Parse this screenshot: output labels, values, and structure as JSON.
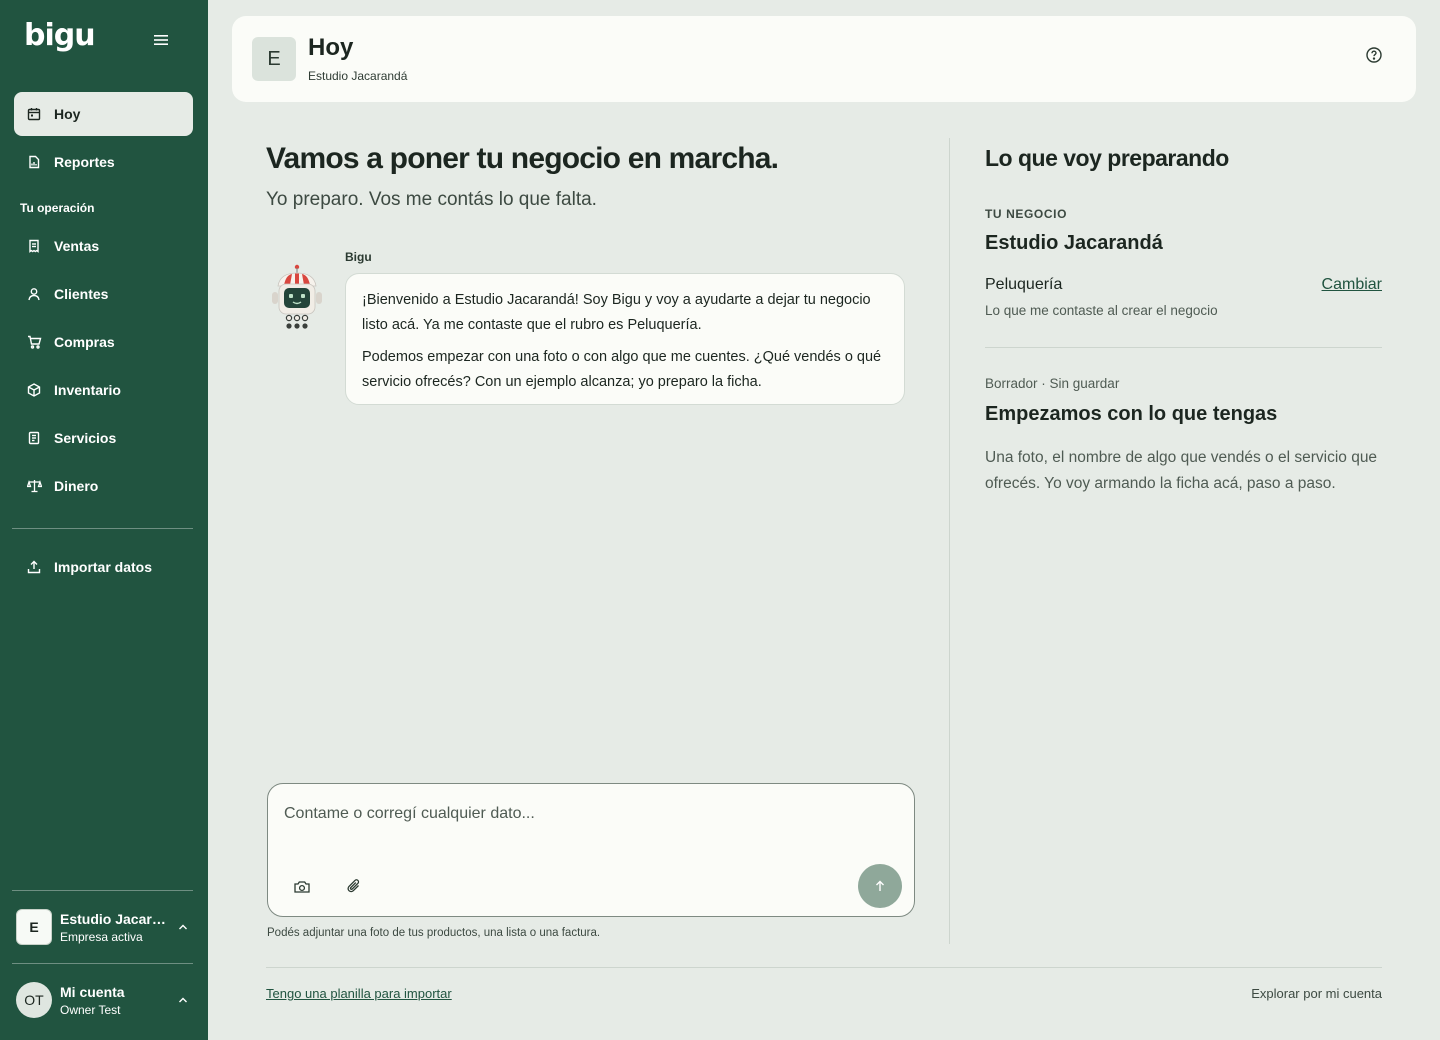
{
  "brand": {
    "logo": "bigu"
  },
  "sidebar": {
    "items": [
      {
        "label": "Hoy",
        "icon": "calendar-icon",
        "active": true
      },
      {
        "label": "Reportes",
        "icon": "report-icon",
        "active": false
      }
    ],
    "section_label": "Tu operación",
    "operation_items": [
      {
        "label": "Ventas",
        "icon": "receipt-icon"
      },
      {
        "label": "Clientes",
        "icon": "user-icon"
      },
      {
        "label": "Compras",
        "icon": "cart-icon"
      },
      {
        "label": "Inventario",
        "icon": "box-icon"
      },
      {
        "label": "Servicios",
        "icon": "document-icon"
      },
      {
        "label": "Dinero",
        "icon": "scale-icon"
      }
    ],
    "import_label": "Importar datos",
    "company": {
      "avatar": "E",
      "name": "Estudio Jacarandá",
      "status": "Empresa activa"
    },
    "account": {
      "avatar": "OT",
      "label": "Mi cuenta",
      "user": "Owner Test"
    }
  },
  "header": {
    "avatar": "E",
    "title": "Hoy",
    "subtitle": "Estudio Jacarandá"
  },
  "main": {
    "title": "Vamos a poner tu negocio en marcha.",
    "subtitle": "Yo preparo. Vos me contás lo que falta.",
    "chat": {
      "sender": "Bigu",
      "paragraphs": [
        "¡Bienvenido a Estudio Jacarandá! Soy Bigu y voy a ayudarte a dejar tu negocio listo acá. Ya me contaste que el rubro es Peluquería.",
        "Podemos empezar con una foto o con algo que me cuentes. ¿Qué vendés o qué servicio ofrecés? Con un ejemplo alcanza; yo preparo la ficha."
      ]
    },
    "composer": {
      "placeholder": "Contame o corregí cualquier dato...",
      "value": "",
      "hint": "Podés adjuntar una foto de tus productos, una lista o una factura."
    },
    "footer": {
      "import_link": "Tengo una planilla para importar",
      "explore_link": "Explorar por mi cuenta"
    }
  },
  "panel": {
    "title": "Lo que voy preparando",
    "section_label": "TU NEGOCIO",
    "business_name": "Estudio Jacarandá",
    "rubro": "Peluquería",
    "change_label": "Cambiar",
    "rubro_note": "Lo que me contaste al crear el negocio",
    "draft_status": "Borrador · Sin guardar",
    "draft_title": "Empezamos con lo que tengas",
    "draft_body": "Una foto, el nombre de algo que vendés o el servicio que ofrecés. Yo voy armando la ficha acá, paso a paso."
  },
  "colors": {
    "sidebar_bg": "#215440",
    "page_bg": "#e6ebe6",
    "card_bg": "#fbfcf8",
    "accent": "#215440",
    "send_button": "#8fa89a",
    "mascot_red": "#d9473f"
  }
}
